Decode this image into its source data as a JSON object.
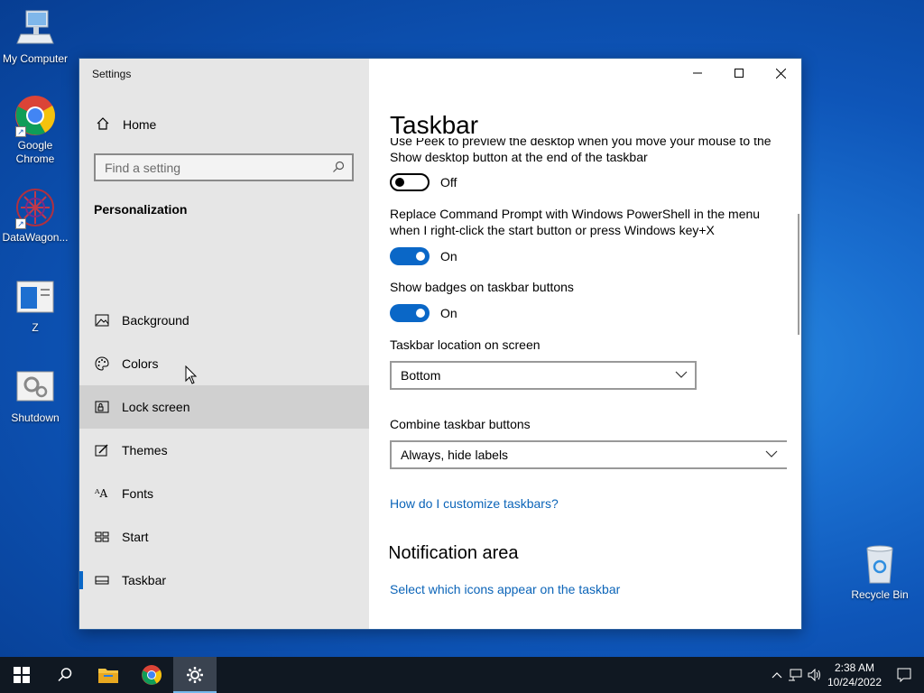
{
  "desktop": {
    "icons": [
      {
        "label": "My Computer"
      },
      {
        "label": "Google Chrome"
      },
      {
        "label": "DataWagon..."
      },
      {
        "label": "Z"
      },
      {
        "label": "Shutdown"
      },
      {
        "label": "Recycle Bin"
      }
    ]
  },
  "window": {
    "title": "Settings",
    "sidebar": {
      "home_label": "Home",
      "search_placeholder": "Find a setting",
      "section_title": "Personalization",
      "items": [
        {
          "label": "Background",
          "icon": "picture-icon"
        },
        {
          "label": "Colors",
          "icon": "palette-icon"
        },
        {
          "label": "Lock screen",
          "icon": "lock-screen-icon"
        },
        {
          "label": "Themes",
          "icon": "themes-icon"
        },
        {
          "label": "Fonts",
          "icon": "fonts-icon"
        },
        {
          "label": "Start",
          "icon": "start-icon"
        },
        {
          "label": "Taskbar",
          "icon": "taskbar-icon"
        }
      ],
      "selected": "Taskbar",
      "hovered": "Lock screen"
    },
    "content": {
      "title": "Taskbar",
      "peek_text": "Use Peek to preview the desktop when you move your mouse to the Show desktop button at the end of the taskbar",
      "peek_state": "Off",
      "powershell_text": "Replace Command Prompt with Windows PowerShell in the menu when I right-click the start button or press Windows key+X",
      "powershell_state": "On",
      "badges_text": "Show badges on taskbar buttons",
      "badges_state": "On",
      "location_label": "Taskbar location on screen",
      "location_value": "Bottom",
      "combine_label": "Combine taskbar buttons",
      "combine_value": "Always, hide labels",
      "customize_link": "How do I customize taskbars?",
      "notification_heading": "Notification area",
      "select_icons_link": "Select which icons appear on the taskbar"
    }
  },
  "taskbar": {
    "time": "2:38 AM",
    "date": "10/24/2022"
  },
  "colors": {
    "accent": "#0a67c7",
    "link": "#0b64b8",
    "sidebar_bg": "#e6e6e6",
    "taskbar_bg": "#101822"
  }
}
